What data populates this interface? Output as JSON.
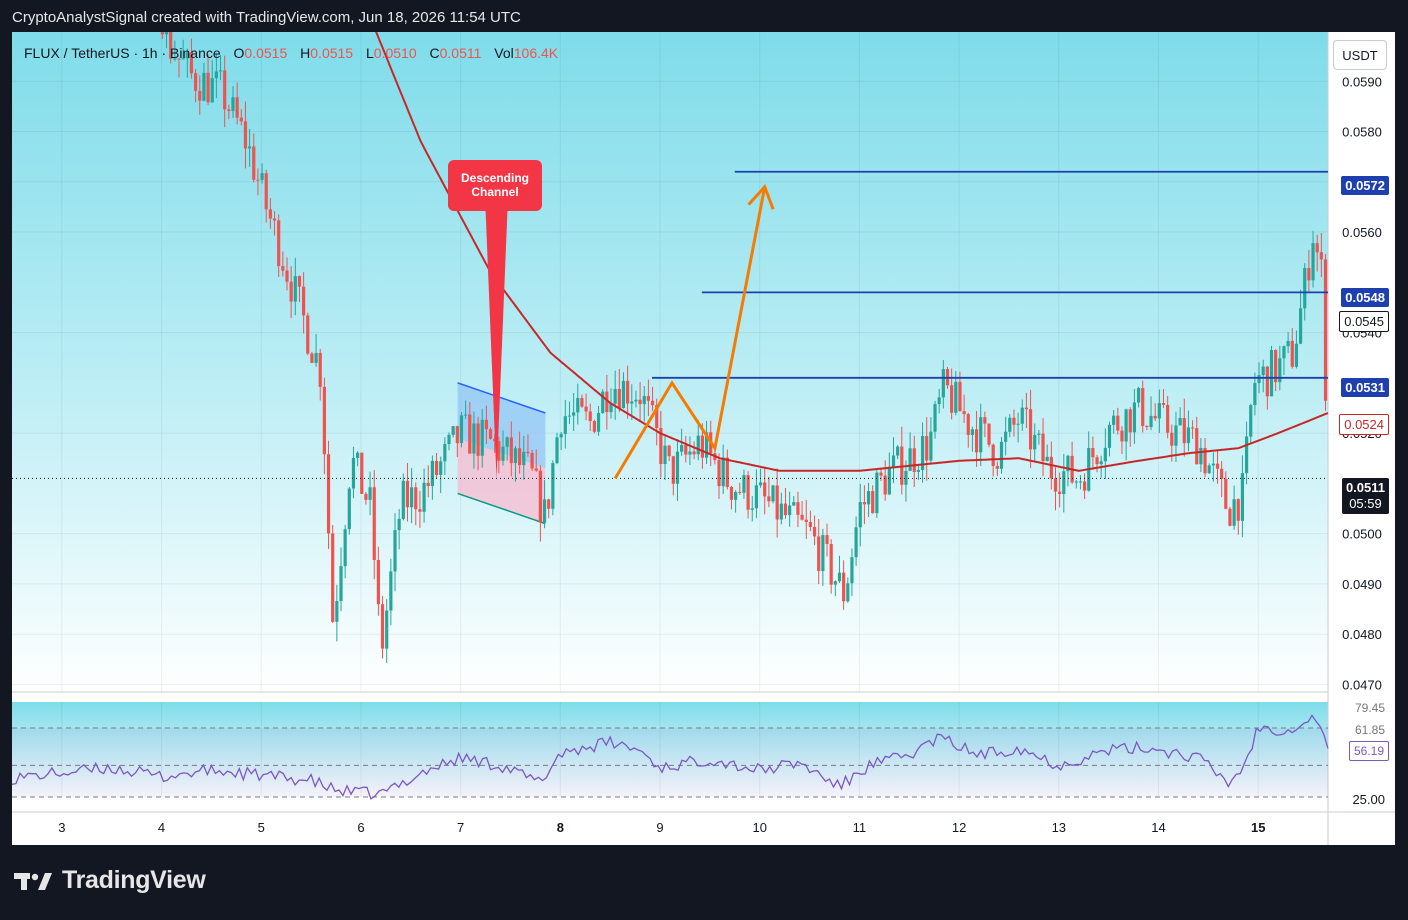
{
  "header": {
    "caption": "CryptoAnalystSignal created with TradingView.com, Jun 18, 2026 11:54 UTC"
  },
  "legend": {
    "pair": "FLUX / TetherUS",
    "interval": "1h",
    "exchange": "Binance",
    "o_label": "O",
    "o_value": "0.0515",
    "h_label": "H",
    "h_value": "0.0515",
    "l_label": "L",
    "l_value": "0.0510",
    "c_label": "C",
    "c_value": "0.0511",
    "vol_label": "Vol",
    "vol_value": "106.4K"
  },
  "toolbar": {
    "currency": "USDT"
  },
  "annotation": {
    "line1": "Descending",
    "line2": "Channel"
  },
  "price_labels": {
    "level_572": "0.0572",
    "level_548": "0.0548",
    "level_545": "0.0545",
    "level_531": "0.0531",
    "ma_value": "0.0524",
    "last_price": "0.0511",
    "countdown": "05:59"
  },
  "rsi_labels": {
    "upper": "79.45",
    "middle": "61.85",
    "current": "56.19",
    "lower": "25.00"
  },
  "brand": {
    "name": "TradingView"
  },
  "colors": {
    "up": "#26a69a",
    "down": "#ef5350",
    "ma": "#c62828",
    "level_line": "#1e3fae",
    "projection": "#f57c00",
    "rsi": "#7e57c2",
    "annotation": "#f23645",
    "channel_fill": "#90c3f5",
    "lower_fill": "#f8bbd0"
  },
  "chart_data": {
    "type": "candlestick",
    "symbol": "FLUX / TetherUS",
    "interval": "1h",
    "y_axis": {
      "ticks": [
        0.047,
        0.048,
        0.049,
        0.05,
        0.052,
        0.054,
        0.056,
        0.057,
        0.058,
        0.059
      ],
      "range": [
        0.04685,
        0.05998
      ]
    },
    "x_axis": {
      "ticks": [
        3,
        4,
        5,
        6,
        7,
        8,
        9,
        10,
        11,
        12,
        13,
        14,
        15
      ],
      "range": [
        2.5,
        15.7
      ]
    },
    "price_key_points": [
      [
        3.1,
        0.0625
      ],
      [
        3.95,
        0.0612
      ],
      [
        4.05,
        0.0598
      ],
      [
        4.3,
        0.0591
      ],
      [
        4.6,
        0.0588
      ],
      [
        4.85,
        0.0578
      ],
      [
        5.05,
        0.0565
      ],
      [
        5.3,
        0.055
      ],
      [
        5.6,
        0.0532
      ],
      [
        5.72,
        0.0482
      ],
      [
        5.9,
        0.0515
      ],
      [
        6.1,
        0.0505
      ],
      [
        6.2,
        0.0476
      ],
      [
        6.4,
        0.0506
      ],
      [
        6.6,
        0.0508
      ],
      [
        6.75,
        0.0512
      ],
      [
        7.0,
        0.052
      ],
      [
        7.3,
        0.0518
      ],
      [
        7.7,
        0.0512
      ],
      [
        7.85,
        0.0503
      ],
      [
        8.0,
        0.0524
      ],
      [
        8.3,
        0.0522
      ],
      [
        8.5,
        0.053
      ],
      [
        8.8,
        0.0528
      ],
      [
        9.1,
        0.0512
      ],
      [
        9.4,
        0.0518
      ],
      [
        9.7,
        0.051
      ],
      [
        10.0,
        0.0507
      ],
      [
        10.5,
        0.05
      ],
      [
        10.85,
        0.0488
      ],
      [
        11.0,
        0.0505
      ],
      [
        11.3,
        0.0512
      ],
      [
        11.7,
        0.0518
      ],
      [
        11.85,
        0.0529
      ],
      [
        12.1,
        0.0522
      ],
      [
        12.4,
        0.0516
      ],
      [
        12.6,
        0.0523
      ],
      [
        12.9,
        0.0513
      ],
      [
        13.2,
        0.0511
      ],
      [
        13.5,
        0.0521
      ],
      [
        13.8,
        0.0525
      ],
      [
        14.1,
        0.0521
      ],
      [
        14.4,
        0.0518
      ],
      [
        14.7,
        0.0505
      ],
      [
        14.85,
        0.0508
      ],
      [
        14.95,
        0.053
      ],
      [
        15.2,
        0.0533
      ],
      [
        15.35,
        0.0536
      ],
      [
        15.45,
        0.0547
      ],
      [
        15.55,
        0.056
      ],
      [
        15.65,
        0.055
      ],
      [
        15.7,
        0.0511
      ]
    ],
    "moving_average_key_points": [
      [
        5.2,
        0.064
      ],
      [
        5.8,
        0.0617
      ],
      [
        6.6,
        0.0578
      ],
      [
        7.3,
        0.0552
      ],
      [
        7.9,
        0.0536
      ],
      [
        8.5,
        0.0526
      ],
      [
        9.0,
        0.052
      ],
      [
        9.6,
        0.0515
      ],
      [
        10.2,
        0.05125
      ],
      [
        11.0,
        0.05125
      ],
      [
        12.0,
        0.05145
      ],
      [
        12.6,
        0.0515
      ],
      [
        13.2,
        0.05125
      ],
      [
        13.8,
        0.05145
      ],
      [
        14.3,
        0.0516
      ],
      [
        14.8,
        0.0517
      ],
      [
        15.2,
        0.052
      ],
      [
        15.7,
        0.0524
      ]
    ],
    "horizontal_levels": [
      {
        "price": 0.0572,
        "x_start": 9.75
      },
      {
        "price": 0.0548,
        "x_start": 9.42
      },
      {
        "price": 0.0531,
        "x_start": 8.92
      }
    ],
    "last_price": 0.0511,
    "moving_average_last": 0.0524,
    "descending_channel": {
      "upper": [
        [
          6.97,
          0.053
        ],
        [
          7.85,
          0.0524
        ]
      ],
      "lower": [
        [
          6.97,
          0.0508
        ],
        [
          7.85,
          0.0502
        ]
      ],
      "mid": [
        [
          6.97,
          0.0519
        ],
        [
          7.85,
          0.0513
        ]
      ]
    },
    "projection_path": [
      [
        8.55,
        0.0511
      ],
      [
        9.12,
        0.053
      ],
      [
        9.55,
        0.0517
      ],
      [
        10.05,
        0.0569
      ]
    ],
    "rsi": {
      "range": [
        25,
        100
      ],
      "levels": [
        25.0,
        50.0,
        79.45
      ],
      "current": 56.19,
      "key_points": [
        [
          2.5,
          40
        ],
        [
          3.0,
          44
        ],
        [
          3.5,
          48
        ],
        [
          4.0,
          41
        ],
        [
          4.5,
          46
        ],
        [
          5.0,
          42
        ],
        [
          5.5,
          38
        ],
        [
          5.75,
          30
        ],
        [
          6.2,
          27
        ],
        [
          6.6,
          44
        ],
        [
          7.0,
          56
        ],
        [
          7.4,
          50
        ],
        [
          7.8,
          36
        ],
        [
          8.0,
          60
        ],
        [
          8.5,
          68
        ],
        [
          8.8,
          62
        ],
        [
          9.0,
          48
        ],
        [
          9.5,
          55
        ],
        [
          10.0,
          46
        ],
        [
          10.4,
          52
        ],
        [
          10.8,
          33
        ],
        [
          11.1,
          50
        ],
        [
          11.5,
          58
        ],
        [
          11.8,
          72
        ],
        [
          12.2,
          58
        ],
        [
          12.6,
          64
        ],
        [
          13.0,
          50
        ],
        [
          13.5,
          62
        ],
        [
          13.9,
          64
        ],
        [
          14.4,
          56
        ],
        [
          14.7,
          36
        ],
        [
          14.85,
          48
        ],
        [
          15.0,
          80
        ],
        [
          15.3,
          78
        ],
        [
          15.5,
          86
        ],
        [
          15.6,
          88
        ],
        [
          15.7,
          62
        ]
      ]
    }
  }
}
